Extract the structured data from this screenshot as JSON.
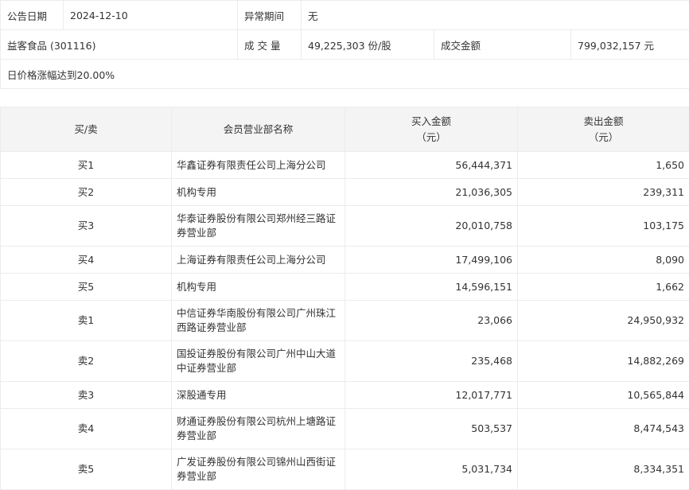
{
  "info": {
    "announce_date_label": "公告日期",
    "announce_date": "2024-12-10",
    "abnormal_period_label": "异常期间",
    "abnormal_period": "无",
    "stock": "益客食品 (301116)",
    "volume_label": "成 交 量",
    "volume": "49,225,303 份/股",
    "turnover_label": "成交金额",
    "turnover": "799,032,157 元",
    "reason": "日价格涨幅达到20.00%"
  },
  "table": {
    "headers": {
      "side": "买/卖",
      "name": "会员营业部名称",
      "buy": "买入金额",
      "buy_unit": "（元）",
      "sell": "卖出金额",
      "sell_unit": "（元）"
    },
    "rows": [
      {
        "side": "买1",
        "name": "华鑫证券有限责任公司上海分公司",
        "buy": "56,444,371",
        "sell": "1,650"
      },
      {
        "side": "买2",
        "name": "机构专用",
        "buy": "21,036,305",
        "sell": "239,311"
      },
      {
        "side": "买3",
        "name": "华泰证券股份有限公司郑州经三路证券营业部",
        "buy": "20,010,758",
        "sell": "103,175"
      },
      {
        "side": "买4",
        "name": "上海证券有限责任公司上海分公司",
        "buy": "17,499,106",
        "sell": "8,090"
      },
      {
        "side": "买5",
        "name": "机构专用",
        "buy": "14,596,151",
        "sell": "1,662"
      },
      {
        "side": "卖1",
        "name": "中信证券华南股份有限公司广州珠江西路证券营业部",
        "buy": "23,066",
        "sell": "24,950,932"
      },
      {
        "side": "卖2",
        "name": "国投证券股份有限公司广州中山大道中证券营业部",
        "buy": "235,468",
        "sell": "14,882,269"
      },
      {
        "side": "卖3",
        "name": "深股通专用",
        "buy": "12,017,771",
        "sell": "10,565,844"
      },
      {
        "side": "卖4",
        "name": "财通证券股份有限公司杭州上塘路证券营业部",
        "buy": "503,537",
        "sell": "8,474,543"
      },
      {
        "side": "卖5",
        "name": "广发证券股份有限公司锦州山西街证券营业部",
        "buy": "5,031,734",
        "sell": "8,334,351"
      }
    ]
  }
}
